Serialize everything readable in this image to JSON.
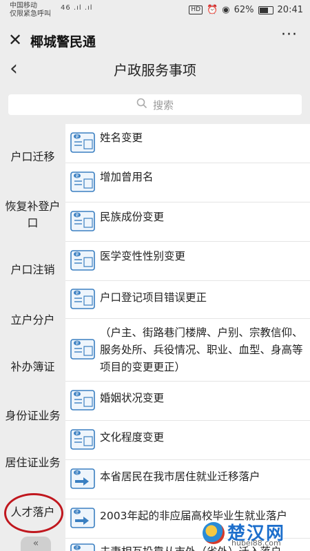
{
  "status": {
    "carrier": "中国移动",
    "carrier_sub": "仅限紧急呼叫",
    "signal": "46 .ıl .ıl",
    "hd": "HD",
    "battery": "62%",
    "time": "20:41"
  },
  "app": {
    "title": "椰城警民通",
    "close": "✕",
    "more": "···"
  },
  "nav": {
    "back": "‹",
    "title": "户政服务事项"
  },
  "search": {
    "placeholder": "搜索"
  },
  "sidebar": {
    "items": [
      "户口迁移",
      "恢复补登户口",
      "户口注销",
      "立户分户",
      "补办簿证",
      "身份证业务",
      "居住证业务",
      "人才落户"
    ],
    "collapse": "«"
  },
  "list": {
    "items": [
      "姓名变更",
      "增加曾用名",
      "民族成份变更",
      "医学变性性别变更",
      "户口登记项目错误更正",
      "（户主、街路巷门楼牌、户别、宗教信仰、服务处所、兵役情况、职业、血型、身高等项目的变更更正）",
      "婚姻状况变更",
      "文化程度变更",
      "本省居民在我市居住就业迁移落户",
      "2003年起的非应届高校毕业生就业落户",
      "夫妻相互投靠从市外（省外）迁入落户"
    ],
    "icon_labels": [
      "更",
      "更",
      "更",
      "更",
      "更",
      "更",
      "更",
      "更",
      "迁",
      "迁",
      "迁"
    ]
  },
  "watermark": {
    "title": "楚汉网",
    "url": "hubei88.com"
  },
  "colors": {
    "highlight": "#c0171e",
    "icon_blue": "#3a7fc1"
  }
}
